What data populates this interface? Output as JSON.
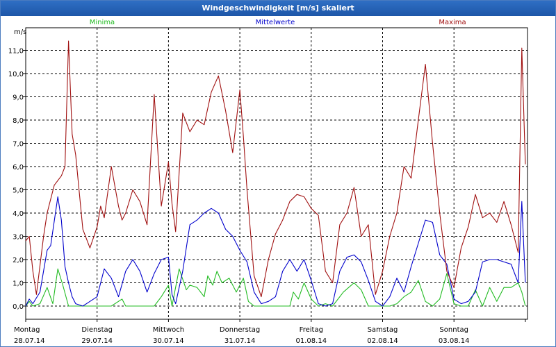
{
  "window": {
    "title": "Windgeschwindigkeit [m/s] skaliert"
  },
  "chart_data": {
    "type": "line",
    "title": "Windgeschwindigkeit [m/s] skaliert",
    "ylabel": "m/s",
    "xlabel": "",
    "ylim": [
      0,
      12
    ],
    "xlim": [
      0,
      7
    ],
    "grid": true,
    "legend_placement": "top",
    "y_ticks": [
      "0,0",
      "1,0",
      "2,0",
      "3,0",
      "4,0",
      "5,0",
      "6,0",
      "7,0",
      "8,0",
      "9,0",
      "10,0",
      "11,0"
    ],
    "x_ticks": [
      {
        "day": "Montag",
        "date": "28.07.14",
        "pos": 0
      },
      {
        "day": "Dienstag",
        "date": "29.07.14",
        "pos": 1
      },
      {
        "day": "Mittwoch",
        "date": "30.07.14",
        "pos": 2
      },
      {
        "day": "Donnerstag",
        "date": "31.07.14",
        "pos": 3
      },
      {
        "day": "Freitag",
        "date": "01.08.14",
        "pos": 4
      },
      {
        "day": "Samstag",
        "date": "02.08.14",
        "pos": 5
      },
      {
        "day": "Sonntag",
        "date": "03.08.14",
        "pos": 6
      }
    ],
    "series": [
      {
        "name": "Minima",
        "color": "#22bb22",
        "x": [
          0,
          0.05,
          0.1,
          0.2,
          0.3,
          0.38,
          0.45,
          0.52,
          0.6,
          0.68,
          0.75,
          0.85,
          1.0,
          1.2,
          1.35,
          1.4,
          1.5,
          1.6,
          1.8,
          1.9,
          2.0,
          2.05,
          2.15,
          2.25,
          2.3,
          2.4,
          2.5,
          2.55,
          2.62,
          2.68,
          2.75,
          2.85,
          2.95,
          3.05,
          3.12,
          3.2,
          3.3,
          3.4,
          3.5,
          3.6,
          3.7,
          3.75,
          3.82,
          3.9,
          4.0,
          4.1,
          4.2,
          4.3,
          4.45,
          4.6,
          4.7,
          4.8,
          4.9,
          5.0,
          5.1,
          5.2,
          5.3,
          5.4,
          5.5,
          5.6,
          5.7,
          5.8,
          5.9,
          6.0,
          6.1,
          6.2,
          6.3,
          6.4,
          6.5,
          6.6,
          6.7,
          6.8,
          6.9,
          6.95,
          7.0
        ],
        "values": [
          0,
          0.2,
          0,
          0.1,
          0.8,
          0.1,
          1.6,
          0.9,
          0,
          0,
          0,
          0,
          0,
          0,
          0.3,
          0,
          0,
          0,
          0,
          0.4,
          0.9,
          0,
          1.6,
          0.7,
          0.9,
          0.8,
          0.4,
          1.3,
          0.9,
          1.5,
          1.0,
          1.2,
          0.6,
          1.2,
          0.2,
          0,
          0,
          0,
          0,
          0,
          0,
          0.6,
          0.3,
          1.0,
          0.3,
          0,
          0.1,
          0,
          0.6,
          1.0,
          0.7,
          0,
          0,
          0,
          0,
          0.1,
          0.4,
          0.6,
          1.1,
          0.2,
          0,
          0.3,
          1.4,
          0.1,
          0,
          0,
          0.7,
          0,
          0.8,
          0.2,
          0.8,
          0.8,
          1.0,
          0.6,
          0
        ]
      },
      {
        "name": "Mittelwerte",
        "color": "#0000cc",
        "x": [
          0,
          0.05,
          0.1,
          0.2,
          0.3,
          0.35,
          0.45,
          0.5,
          0.55,
          0.6,
          0.65,
          0.7,
          0.8,
          1.0,
          1.1,
          1.2,
          1.3,
          1.4,
          1.5,
          1.6,
          1.7,
          1.8,
          1.9,
          2.0,
          2.05,
          2.1,
          2.2,
          2.3,
          2.4,
          2.5,
          2.6,
          2.7,
          2.8,
          2.9,
          3.0,
          3.1,
          3.2,
          3.3,
          3.4,
          3.5,
          3.6,
          3.7,
          3.8,
          3.9,
          4.0,
          4.1,
          4.2,
          4.3,
          4.4,
          4.5,
          4.6,
          4.7,
          4.8,
          4.9,
          5.0,
          5.1,
          5.2,
          5.3,
          5.4,
          5.5,
          5.6,
          5.7,
          5.8,
          5.9,
          6.0,
          6.1,
          6.2,
          6.3,
          6.4,
          6.5,
          6.6,
          6.7,
          6.8,
          6.9,
          6.95,
          7.0
        ],
        "values": [
          0,
          0.3,
          0.1,
          0.6,
          2.4,
          2.6,
          4.7,
          3.7,
          1.7,
          1.0,
          0.4,
          0.1,
          0,
          0.4,
          1.6,
          1.2,
          0.4,
          1.5,
          2.0,
          1.5,
          0.6,
          1.4,
          2.0,
          2.1,
          0.5,
          0.1,
          1.5,
          3.5,
          3.7,
          4.0,
          4.2,
          4.0,
          3.3,
          3.0,
          2.4,
          1.9,
          0.6,
          0.1,
          0.2,
          0.4,
          1.5,
          2.0,
          1.5,
          2.0,
          1.1,
          0.1,
          0,
          0.1,
          1.5,
          2.1,
          2.2,
          1.9,
          1.1,
          0.2,
          0,
          0.4,
          1.2,
          0.6,
          1.7,
          2.7,
          3.7,
          3.6,
          2.2,
          1.8,
          0.3,
          0.1,
          0.2,
          0.6,
          1.9,
          2.0,
          2.0,
          1.9,
          1.8,
          1.0,
          4.5,
          1.0
        ]
      },
      {
        "name": "Maxima",
        "color": "#a01010",
        "x": [
          0,
          0.05,
          0.1,
          0.15,
          0.25,
          0.3,
          0.4,
          0.5,
          0.55,
          0.6,
          0.65,
          0.7,
          0.8,
          0.9,
          1.0,
          1.05,
          1.1,
          1.2,
          1.3,
          1.35,
          1.4,
          1.5,
          1.6,
          1.7,
          1.8,
          1.9,
          2.0,
          2.05,
          2.1,
          2.2,
          2.3,
          2.4,
          2.5,
          2.6,
          2.7,
          2.8,
          2.9,
          3.0,
          3.05,
          3.1,
          3.2,
          3.3,
          3.4,
          3.5,
          3.6,
          3.7,
          3.8,
          3.9,
          4.0,
          4.1,
          4.2,
          4.3,
          4.4,
          4.5,
          4.6,
          4.7,
          4.8,
          4.9,
          5.0,
          5.1,
          5.2,
          5.3,
          5.4,
          5.5,
          5.6,
          5.7,
          5.8,
          5.9,
          6.0,
          6.1,
          6.2,
          6.3,
          6.4,
          6.5,
          6.6,
          6.7,
          6.8,
          6.9,
          6.95,
          7.0
        ],
        "values": [
          2.8,
          3.0,
          1.5,
          0.5,
          3.0,
          4.0,
          5.2,
          5.6,
          6.0,
          11.4,
          7.4,
          6.5,
          3.3,
          2.5,
          3.4,
          4.3,
          3.8,
          6.0,
          4.3,
          3.7,
          4.0,
          5.0,
          4.5,
          3.5,
          9.1,
          4.3,
          6.2,
          4.4,
          3.2,
          8.3,
          7.5,
          8.0,
          7.8,
          9.2,
          9.9,
          8.4,
          6.6,
          9.3,
          7.3,
          5.0,
          1.3,
          0.4,
          2.0,
          3.1,
          3.7,
          4.5,
          4.8,
          4.7,
          4.2,
          3.9,
          1.5,
          1.0,
          3.5,
          4.0,
          5.1,
          3.0,
          3.5,
          0.5,
          1.5,
          3.0,
          4.0,
          6.0,
          5.5,
          8.0,
          10.4,
          7.0,
          4.0,
          1.5,
          0.8,
          2.5,
          3.4,
          4.8,
          3.8,
          4.0,
          3.6,
          4.5,
          3.5,
          2.3,
          11.1,
          6.1
        ]
      }
    ]
  }
}
